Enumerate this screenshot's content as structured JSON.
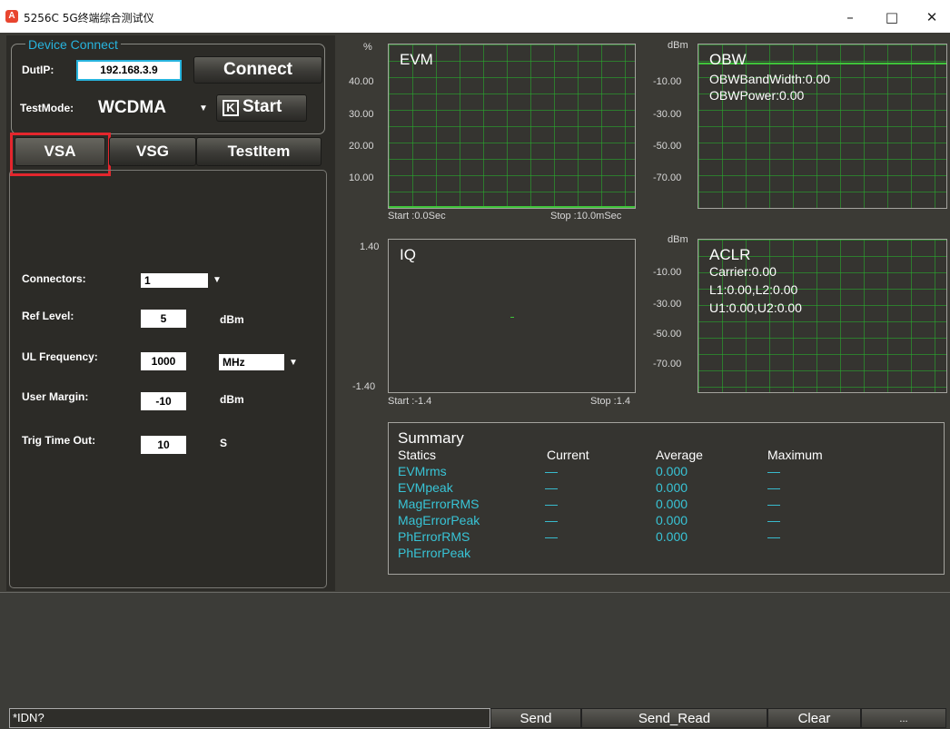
{
  "window": {
    "title": "5256C 5G终端综合测试仪",
    "icon_letter": "A",
    "minimize": "–",
    "maximize": "□",
    "close": "✕"
  },
  "device": {
    "legend": "Device Connect",
    "dutip_label": "DutIP:",
    "dutip_value": "192.168.3.9",
    "connect_label": "Connect",
    "testmode_label": "TestMode:",
    "testmode_value": "WCDMA",
    "start_icon": "K",
    "start_label": "Start"
  },
  "tabs": [
    "VSA",
    "VSG",
    "TestItem"
  ],
  "vsa": {
    "connectors_label": "Connectors:",
    "connectors_value": "1",
    "ref_label": "Ref Level:",
    "ref_value": "5",
    "ref_unit": "dBm",
    "ul_label": "UL Frequency:",
    "ul_value": "1000",
    "ul_unit": "MHz",
    "margin_label": "User Margin:",
    "margin_value": "-10",
    "margin_unit": "dBm",
    "trig_label": "Trig Time Out:",
    "trig_value": "10",
    "trig_unit": "S"
  },
  "evm": {
    "title": "EVM",
    "unit": "%",
    "ticks": [
      "40.00",
      "30.00",
      "20.00",
      "10.00"
    ],
    "start": "Start :0.0Sec",
    "stop": "Stop :10.0mSec"
  },
  "obw": {
    "title": "OBW",
    "unit": "dBm",
    "ticks": [
      "-10.00",
      "-30.00",
      "-50.00",
      "-70.00"
    ],
    "line1": "OBWBandWidth:0.00",
    "line2": "OBWPower:0.00"
  },
  "iq": {
    "title": "IQ",
    "top": "1.40",
    "bottom": "-1.40",
    "start": "Start :-1.4",
    "stop": "Stop :1.4"
  },
  "aclr": {
    "title": "ACLR",
    "unit": "dBm",
    "ticks": [
      "-10.00",
      "-30.00",
      "-50.00",
      "-70.00"
    ],
    "line1": "Carrier:0.00",
    "line2": "L1:0.00,L2:0.00",
    "line3": "U1:0.00,U2:0.00"
  },
  "summary": {
    "title": "Summary",
    "headers": [
      "Statics",
      "Current",
      "Average",
      "Maximum"
    ],
    "rows": [
      {
        "name": "EVMrms",
        "current": "—",
        "average": "0.000",
        "maximum": "—"
      },
      {
        "name": "EVMpeak",
        "current": "—",
        "average": "0.000",
        "maximum": "—"
      },
      {
        "name": "MagErrorRMS",
        "current": "—",
        "average": "0.000",
        "maximum": "—"
      },
      {
        "name": "MagErrorPeak",
        "current": "—",
        "average": "0.000",
        "maximum": "—"
      },
      {
        "name": "PhErrorRMS",
        "current": "—",
        "average": "0.000",
        "maximum": "—"
      },
      {
        "name": "PhErrorPeak",
        "current": "",
        "average": "",
        "maximum": ""
      }
    ]
  },
  "bottom": {
    "command": "*IDN?",
    "send": "Send",
    "send_read": "Send_Read",
    "clear": "Clear",
    "extra": "..."
  }
}
